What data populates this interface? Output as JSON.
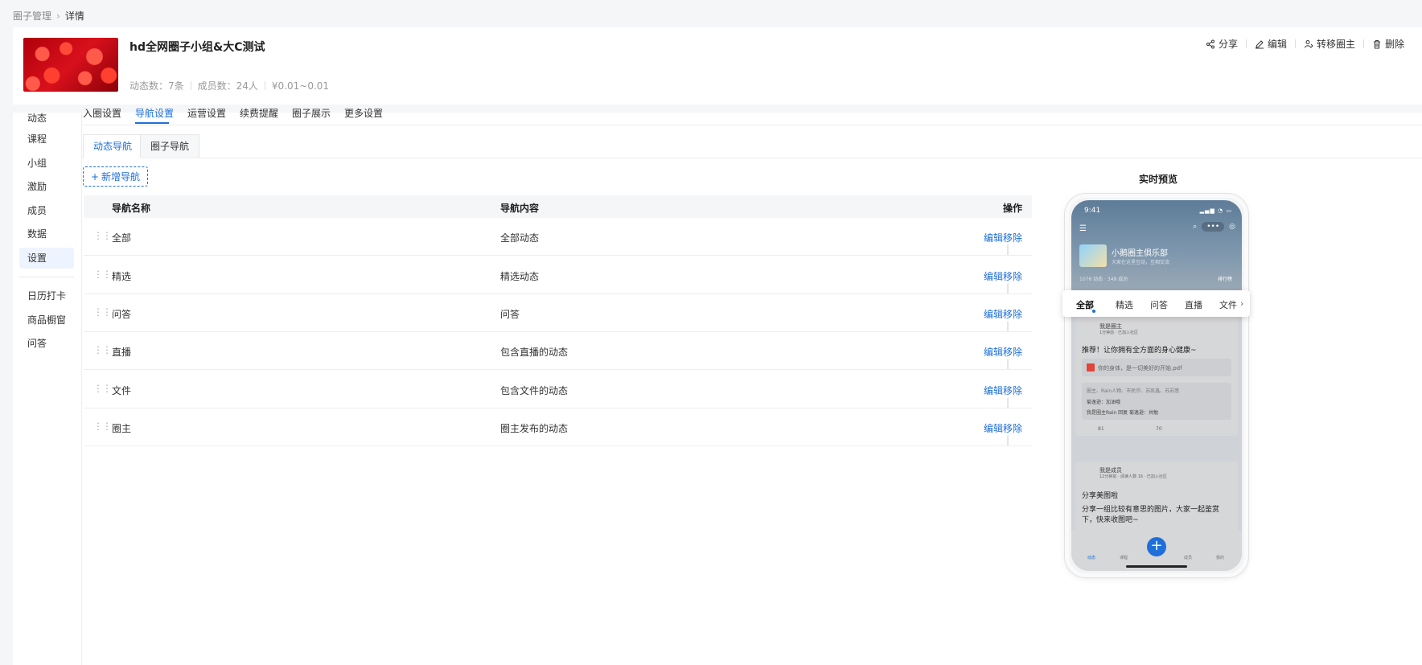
{
  "breadcrumb": {
    "parent": "圈子管理",
    "current": "详情"
  },
  "header": {
    "title": "hd全网圈子小组&大C测试",
    "stats": [
      "动态数：7条",
      "成员数：24人",
      "¥0.01~0.01"
    ],
    "actions": [
      {
        "label": "分享",
        "icon": "share-icon"
      },
      {
        "label": "编辑",
        "icon": "edit-icon"
      },
      {
        "label": "转移圈主",
        "icon": "user-transfer-icon"
      },
      {
        "label": "删除",
        "icon": "trash-icon"
      }
    ]
  },
  "sidenav": {
    "items": [
      "动态",
      "课程",
      "小组",
      "激励",
      "成员",
      "数据",
      "设置",
      "日历打卡",
      "商品橱窗",
      "问答"
    ],
    "active": "设置"
  },
  "tabs": [
    "入圈设置",
    "导航设置",
    "运营设置",
    "续费提醒",
    "圈子展示",
    "更多设置"
  ],
  "active_tab": "导航设置",
  "subtabs": [
    "动态导航",
    "圈子导航"
  ],
  "active_subtab": "动态导航",
  "add_button": "新增导航",
  "table": {
    "headers": {
      "name": "导航名称",
      "content": "导航内容",
      "ops": "操作"
    },
    "rows": [
      {
        "name": "全部",
        "content": "全部动态"
      },
      {
        "name": "精选",
        "content": "精选动态"
      },
      {
        "name": "问答",
        "content": "问答"
      },
      {
        "name": "直播",
        "content": "包含直播的动态"
      },
      {
        "name": "文件",
        "content": "包含文件的动态"
      },
      {
        "name": "圈主",
        "content": "圈主发布的动态"
      }
    ],
    "op_edit": "编辑",
    "op_remove": "移除"
  },
  "preview": {
    "label": "实时预览",
    "time": "9:41",
    "circle_name": "小鹅圈主俱乐部",
    "circle_desc": "大家在这里互动，互相交流",
    "circle_meta": "1076 动态 · 349 成员",
    "rank_label": "排行榜",
    "nav_tabs": [
      "全部",
      "精选",
      "问答",
      "直播",
      "文件"
    ],
    "post1": {
      "author": "我是圈主",
      "badge": "圈主",
      "meta": "1分钟前 · 已加入社区",
      "text": "推荐！让你拥有全方面的身心健康~",
      "file": "你的身体，是一切美好的开始.pdf",
      "likes": "圈主、Rain人物、市民宗、苏凯鑫、苏苏悠",
      "comment1": "菊逸逊：加油哦",
      "comment2": "我是圈主Rain 回复 菊逸逊：共勉",
      "like_count": "81",
      "comment_count": "70"
    },
    "post2": {
      "author": "我是成员",
      "meta": "12分钟前 · 阅读人数 16 · 已加入社区",
      "title": "分享美图啦",
      "text": "分享一组比较有意思的图片，大家一起鉴赏下，快来收图吧~"
    },
    "bottom_nav": [
      "动态",
      "课程",
      "成员",
      "我的"
    ]
  }
}
